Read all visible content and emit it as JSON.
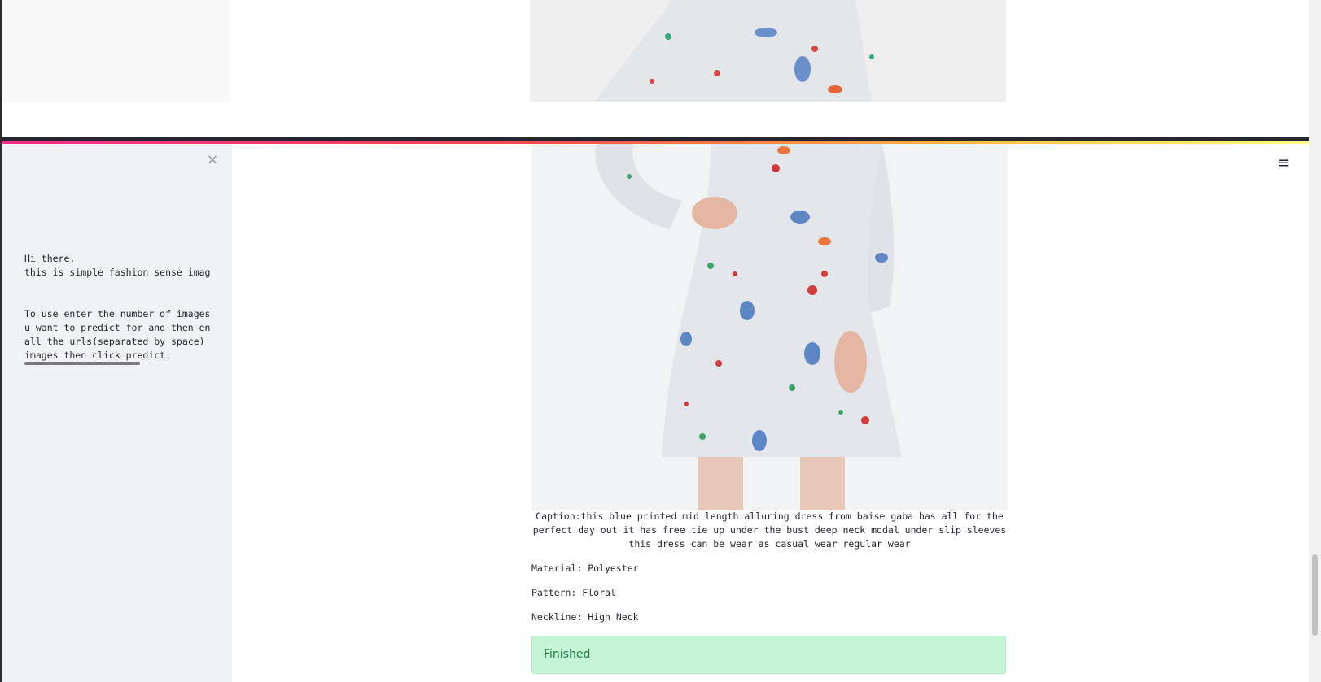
{
  "sidebar": {
    "close_label": "×",
    "intro": "Hi there,\nthis is simple fashion sense image captioning\n\n\nTo use enter the number of images\nu want to predict for and then enter\nall the urls(separated by space) of\nimages then click predict."
  },
  "header": {
    "menu_label": "≡"
  },
  "result": {
    "caption": "Caption:this blue printed mid length alluring dress from baise gaba has all for the perfect day out it has free tie up under the bust deep neck modal under slip sleeves this dress can be wear as casual wear regular wear",
    "material": "Material: Polyester",
    "pattern": "Pattern: Floral",
    "neckline": "Neckline: High Neck",
    "status": "Finished"
  },
  "colors": {
    "accent_gradient": [
      "#ff2b8a",
      "#ff4b4b",
      "#ffbd45",
      "#fffd80"
    ],
    "success_bg": "#c6f4d6",
    "success_text": "#17803d"
  }
}
